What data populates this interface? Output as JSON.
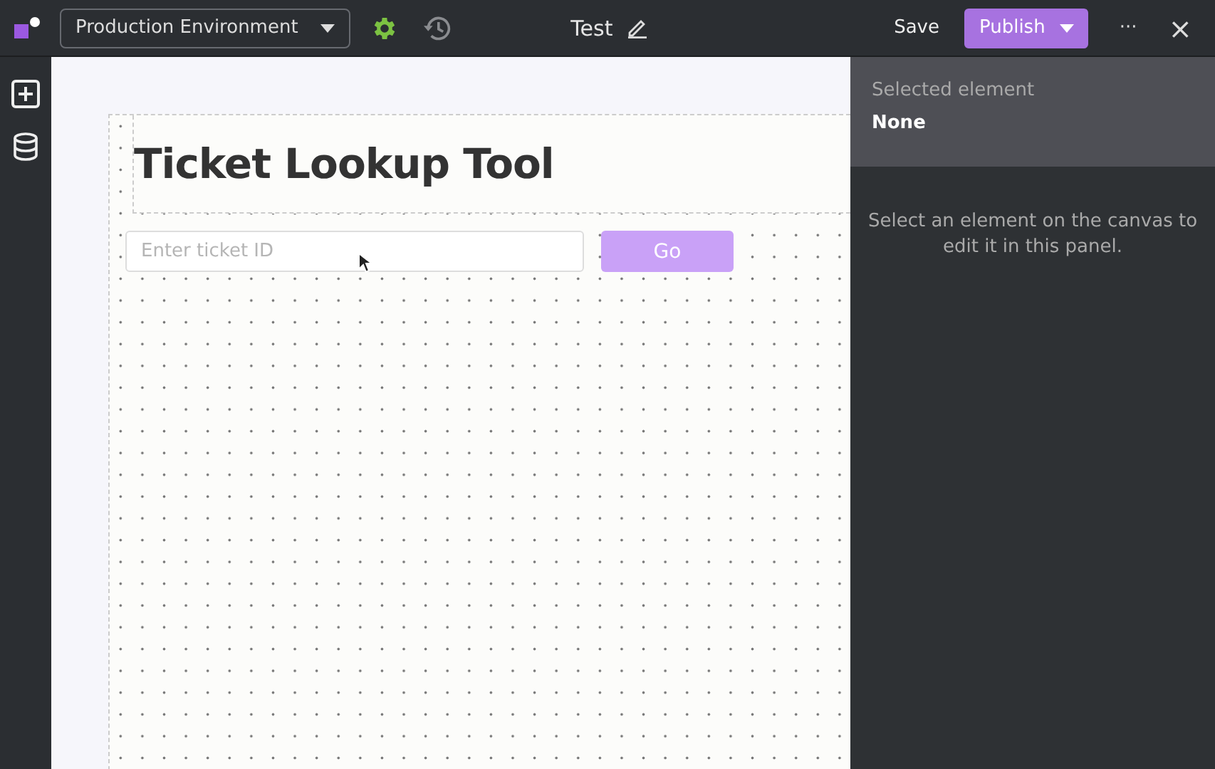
{
  "toolbar": {
    "environment": "Production Environment",
    "app_title": "Test",
    "save": "Save",
    "publish": "Publish",
    "more": "···",
    "close": "×"
  },
  "canvas": {
    "heading": "Ticket Lookup Tool",
    "input": {
      "placeholder": "Enter ticket ID"
    },
    "button": "Go"
  },
  "panel": {
    "label": "Selected element",
    "value": "None",
    "hint": "Select an element on the canvas to edit it in this panel."
  }
}
